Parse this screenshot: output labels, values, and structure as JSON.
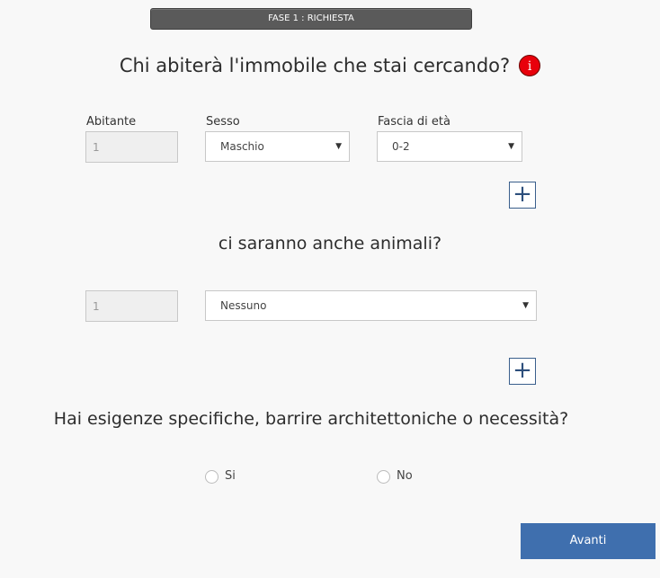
{
  "step": {
    "label": "FASE 1 : RICHIESTA"
  },
  "question_residents": {
    "text": "Chi abiterà l'immobile che stai cercando?",
    "info_glyph": "i"
  },
  "residents": {
    "col_abitante": "Abitante",
    "col_sesso": "Sesso",
    "col_eta": "Fascia di età",
    "abitante_value": "1",
    "sesso_value": "Maschio",
    "eta_value": "0-2",
    "add_glyph": "+"
  },
  "question_animals": {
    "text": "ci saranno anche animali?"
  },
  "animals": {
    "count_value": "1",
    "type_value": "Nessuno",
    "add_glyph": "+"
  },
  "question_needs": {
    "text": "Hai esigenze specifiche, barrire architettoniche o necessità?",
    "option_yes": "Si",
    "option_no": "No"
  },
  "footer": {
    "next_label": "Avanti"
  },
  "colors": {
    "accent": "#3f6fae",
    "info": "#e8000b",
    "stepbar": "#5a5a5a"
  }
}
